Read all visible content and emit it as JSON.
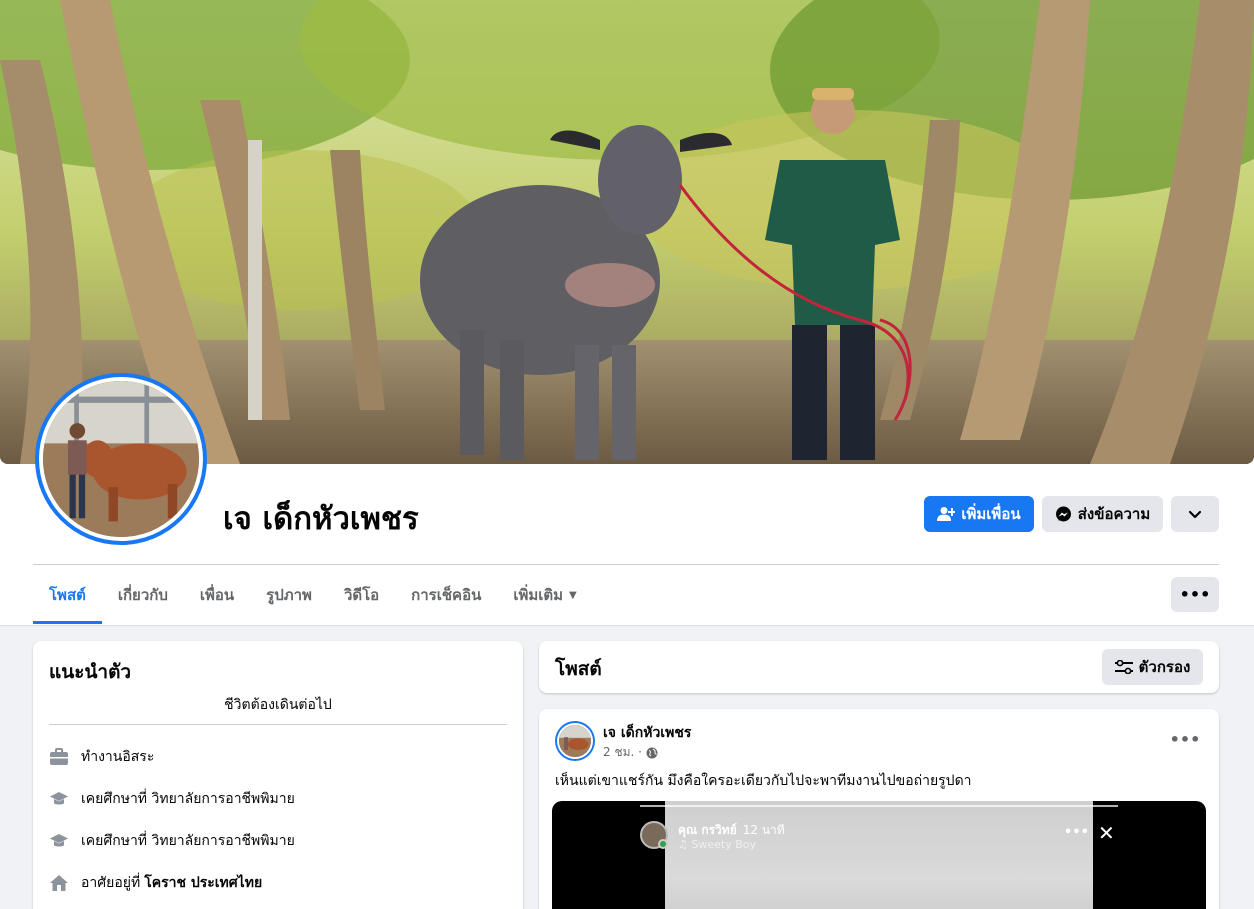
{
  "profile": {
    "name": "เจ เด็กหัวเพชร"
  },
  "actions": {
    "add_friend": "เพิ่มเพื่อน",
    "message": "ส่งข้อความ"
  },
  "tabs": [
    {
      "label": "โพสต์",
      "active": true
    },
    {
      "label": "เกี่ยวกับ",
      "active": false
    },
    {
      "label": "เพื่อน",
      "active": false
    },
    {
      "label": "รูปภาพ",
      "active": false
    },
    {
      "label": "วิดีโอ",
      "active": false
    },
    {
      "label": "การเช็คอิน",
      "active": false
    },
    {
      "label": "เพิ่มเติม",
      "active": false
    }
  ],
  "intro": {
    "title": "แนะนำตัว",
    "bio": "ชีวิตต้องเดินต่อไป",
    "items": [
      {
        "icon": "briefcase-icon",
        "text": "ทำงานอิสระ"
      },
      {
        "icon": "graduation-cap-icon",
        "text": "เคยศึกษาที่ วิทยาลัยการอาชีพพิมาย"
      },
      {
        "icon": "graduation-cap-icon",
        "text": "เคยศึกษาที่ วิทยาลัยการอาชีพพิมาย"
      },
      {
        "icon": "home-icon",
        "text": "อาศัยอยู่ที่",
        "bold": "โคราช ประเทศไทย"
      }
    ]
  },
  "posts_header": {
    "title": "โพสต์",
    "filter_label": "ตัวกรอง"
  },
  "post": {
    "author": "เจ เด็กหัวเพชร",
    "time": "2 ชม. ·",
    "text": "เห็นแต่เขาแชร์กัน มึงคือใครอะเดียวกับไปจะพาทีมงานไปขอถ่ายรูปดา",
    "story": {
      "name": "คุณ กรวิทย์",
      "time": "12 นาที",
      "song": "♫ Sweety Boy"
    }
  },
  "colors": {
    "accent": "#1877f2",
    "secondary_button": "#e4e6eb",
    "page_background": "#f0f2f5"
  }
}
